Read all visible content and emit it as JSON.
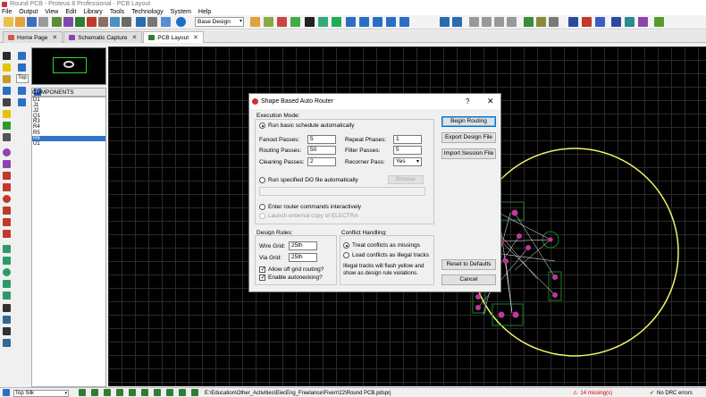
{
  "window": {
    "title": "Round PCB - Proteus 8 Professional - PCB Layout"
  },
  "menu": [
    "File",
    "Output",
    "View",
    "Edit",
    "Library",
    "Tools",
    "Technology",
    "System",
    "Help"
  ],
  "toolbar": {
    "design_select": "Base Design"
  },
  "tabs": [
    {
      "label": "Home Page",
      "icon_color": "#d9534f"
    },
    {
      "label": "Schematic Capture",
      "icon_color": "#8e44ad"
    },
    {
      "label": "PCB Layout",
      "icon_color": "#2e7d32"
    }
  ],
  "components": {
    "header": "COMPONENTS",
    "picker": "P",
    "layer_field": "Top",
    "items": [
      "D1",
      "J1",
      "J2",
      "Q1",
      "R3",
      "R4",
      "R5",
      "R6",
      "U1"
    ],
    "selected": "R6"
  },
  "dialog": {
    "title": "Shape Based Auto Router",
    "help": "?",
    "close": "✕",
    "execution_mode": {
      "label": "Execution Mode:",
      "run_basic": "Run basic schedule automatically",
      "fanout_label": "Fanout Passes:",
      "fanout_value": "5",
      "routing_label": "Routing Passes:",
      "routing_value": "50",
      "cleaning_label": "Cleaning Passes:",
      "cleaning_value": "2",
      "repeat_label": "Repeat Phases:",
      "repeat_value": "1",
      "filter_label": "Filter Passes:",
      "filter_value": "5",
      "recorner_label": "Recorner Pass:",
      "recorner_value": "Yes",
      "run_do": "Run specified DO file automatically",
      "browse": "Browse",
      "interactive": "Enter router commands interactively",
      "launch_external": "Launch external copy of ELECTRA"
    },
    "design_rules": {
      "label": "Design Rules:",
      "wire_grid_label": "Wire Grid:",
      "wire_grid_value": "25th",
      "via_grid_label": "Via Grid:",
      "via_grid_value": "25th",
      "allow_off_grid": "Allow off grid routing?",
      "enable_autonecking": "Enable autonecking?"
    },
    "conflict_handling": {
      "label": "Conflict Handling:",
      "treat_missing": "Treat conflicts as missings",
      "load_illegal": "Load conflicts as illegal tracks",
      "note": "Illegal tracks will flash yellow and show as design rule violations."
    },
    "buttons": {
      "begin_routing": "Begin Routing",
      "export_design": "Export Design File",
      "import_session": "Import Session File",
      "reset_defaults": "Reset to Defaults",
      "cancel": "Cancel"
    }
  },
  "status": {
    "layer": "Top Silk",
    "path": "E:\\Education\\Other_Activities\\ElecEng_Freelance\\Fiverr\\22\\Round PCB.pdsprj",
    "missing": "14 missing(s)",
    "drc": "No DRC errors"
  },
  "colors": {
    "board_outline": "#f2f26a",
    "pads": "#c2379e",
    "tracks": "#1d7f2a",
    "ratsnest": "#ffffff",
    "accent": "#0078d7"
  }
}
